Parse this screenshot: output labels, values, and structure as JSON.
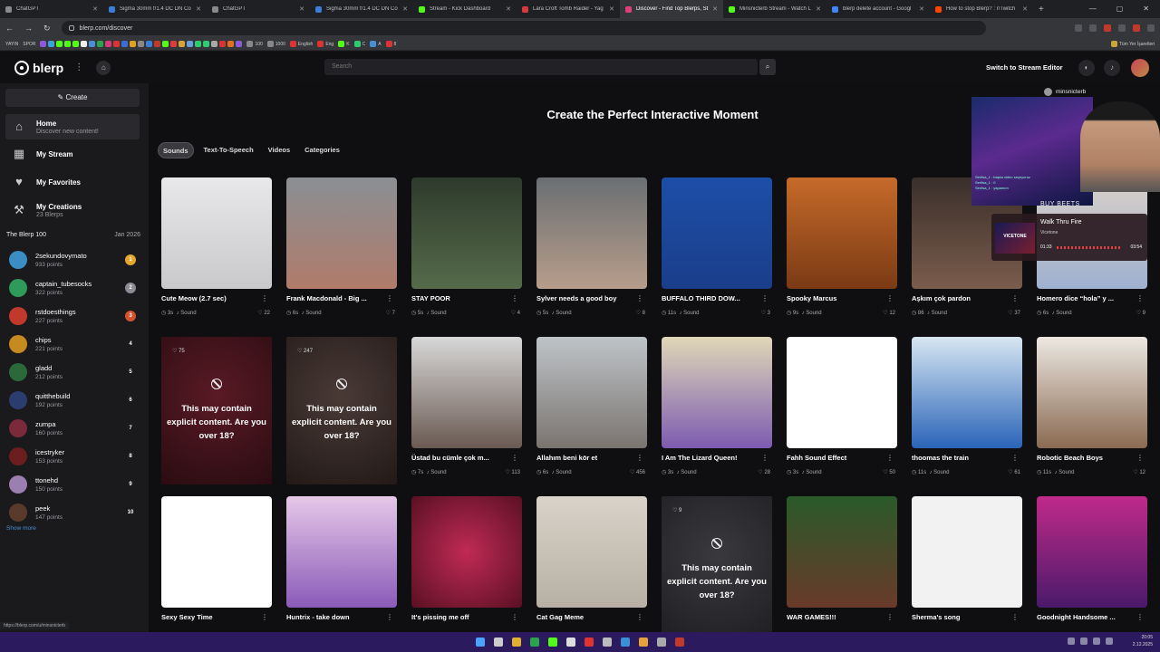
{
  "browser": {
    "tabs": [
      {
        "title": "ChatGPT",
        "color": "#8a8a8a",
        "active": false
      },
      {
        "title": "Sigma 30mm f/1.4 DC DN Co",
        "color": "#3b7dd8",
        "active": false
      },
      {
        "title": "ChatGPT",
        "color": "#8a8a8a",
        "active": false
      },
      {
        "title": "Sigma 30mm f/1.4 DC DN Co",
        "color": "#3b7dd8",
        "active": false
      },
      {
        "title": "Stream - Kick Dashboard",
        "color": "#53fc18",
        "active": false
      },
      {
        "title": "Lara Croft Tomb Raider - Yag",
        "color": "#d63a3a",
        "active": false
      },
      {
        "title": "Discover - Find Top Blerps, St",
        "color": "#e0407a",
        "active": true
      },
      {
        "title": "Minsnicterb Stream - Watch L",
        "color": "#53fc18",
        "active": false
      },
      {
        "title": "blerp delete account - Googl",
        "color": "#4285f4",
        "active": false
      },
      {
        "title": "How to stop Blerp? : r/Twitch",
        "color": "#ff4500",
        "active": false
      }
    ],
    "url": "blerp.com/discover",
    "bookmarks": [
      "YAYIN",
      "SPOR",
      "100",
      "1000",
      "English",
      "Eng",
      "K",
      "C",
      "A",
      "8"
    ],
    "bookmarks_folder": "Tüm Yer İşaretleri",
    "status_url": "https://blerp.com/u/minsnicterb"
  },
  "header": {
    "logo": "blerp",
    "search_placeholder": "Search",
    "switch_label": "Switch to Stream Editor"
  },
  "sidebar": {
    "create_label": "Create",
    "nav": [
      {
        "label": "Home",
        "sub": "Discover new content!",
        "icon": "home-icon"
      },
      {
        "label": "My Stream",
        "sub": "",
        "icon": "stream-icon"
      },
      {
        "label": "My Favorites",
        "sub": "",
        "icon": "heart-icon"
      },
      {
        "label": "My Creations",
        "sub": "23 Blerps",
        "icon": "hammer-icon"
      }
    ],
    "blerp100_title": "The Blerp 100",
    "blerp100_date": "Jan 2026",
    "leaderboard": [
      {
        "name": "2sekundovymato",
        "points": "933 points",
        "rank": "1",
        "color": "#3a8ec4",
        "rank_color": "#e3a82b"
      },
      {
        "name": "captain_tubesocks",
        "points": "322 points",
        "rank": "2",
        "color": "#2f9b5a",
        "rank_color": "#8c8c94"
      },
      {
        "name": "rstdoesthings",
        "points": "227 points",
        "rank": "3",
        "color": "#c0392b",
        "rank_color": "#d3532f"
      },
      {
        "name": "chips",
        "points": "221 points",
        "rank": "4",
        "color": "#c78a20",
        "rank_color": "transparent"
      },
      {
        "name": "gladd",
        "points": "212 points",
        "rank": "5",
        "color": "#2a6a3a",
        "rank_color": "transparent"
      },
      {
        "name": "quitthebuild",
        "points": "192 points",
        "rank": "6",
        "color": "#2b3d6f",
        "rank_color": "transparent"
      },
      {
        "name": "zumpa",
        "points": "160 points",
        "rank": "7",
        "color": "#7a2a3a",
        "rank_color": "transparent"
      },
      {
        "name": "icestryker",
        "points": "153 points",
        "rank": "8",
        "color": "#6a1e1e",
        "rank_color": "transparent"
      },
      {
        "name": "ttonehd",
        "points": "150 points",
        "rank": "9",
        "color": "#9a7fb0",
        "rank_color": "transparent"
      },
      {
        "name": "peek",
        "points": "147 points",
        "rank": "10",
        "color": "#5a3a2a",
        "rank_color": "transparent"
      }
    ],
    "show_more": "Show more"
  },
  "main": {
    "heading": "Create the Perfect Interactive Moment",
    "tabs": [
      "Sounds",
      "Text-To-Speech",
      "Videos",
      "Categories"
    ],
    "warning": "This may contain explicit content. Are you over 18?",
    "sound_label": "Sound",
    "cards": [
      {
        "title": "Cute Meow (2.7 sec)",
        "dur": "3s",
        "likes": "22",
        "bg": "linear-gradient(180deg,#e8e8ea,#c9c9cc)",
        "explicit": false
      },
      {
        "title": "Frank Macdonald - Big ...",
        "dur": "6s",
        "likes": "7",
        "bg": "linear-gradient(180deg,#8a8f94,#b07b6a)",
        "explicit": false
      },
      {
        "title": "STAY POOR",
        "dur": "5s",
        "likes": "4",
        "bg": "linear-gradient(180deg,#2e3a2c,#556b4a)",
        "explicit": false
      },
      {
        "title": "Sylver needs a good boy",
        "dur": "5s",
        "likes": "8",
        "bg": "linear-gradient(180deg,#6a6f73,#b79d8a)",
        "explicit": false
      },
      {
        "title": "BUFFALO THIRD DOW...",
        "dur": "11s",
        "likes": "3",
        "bg": "linear-gradient(180deg,#1d4ea8,#1a3e8a)",
        "explicit": false
      },
      {
        "title": "Spooky Marcus",
        "dur": "9s",
        "likes": "12",
        "bg": "linear-gradient(180deg,#c66a2a,#7a3a14)",
        "explicit": false
      },
      {
        "title": "Aşkım çok pardon",
        "dur": "86",
        "likes": "37",
        "bg": "linear-gradient(180deg,#3a2f2b,#7a5c4c)",
        "explicit": false
      },
      {
        "title": "Homero dice “hola” y ...",
        "dur": "6s",
        "likes": "9",
        "bg": "linear-gradient(180deg,#d8d0c8,#9fb0d0)",
        "explicit": false
      },
      {
        "title": "",
        "dur": "",
        "likes": "75",
        "bg": "radial-gradient(circle at 50% 40%,#5a1a24,#2a0c12)",
        "explicit": true
      },
      {
        "title": "",
        "dur": "",
        "likes": "247",
        "bg": "radial-gradient(circle at 50% 40%,#4a3a36,#221a18)",
        "explicit": true
      },
      {
        "title": "Üstad bu cümle çok m...",
        "dur": "7s",
        "likes": "113",
        "bg": "linear-gradient(180deg,#d8d8d8,#6a5a52)",
        "explicit": false
      },
      {
        "title": "Allahım beni kör et",
        "dur": "6s",
        "likes": "456",
        "bg": "linear-gradient(180deg,#bfc4c8,#7a7470)",
        "explicit": false
      },
      {
        "title": "I Am The Lizard Queen!",
        "dur": "3s",
        "likes": "28",
        "bg": "linear-gradient(180deg,#e0d8b8,#7c5bb0)",
        "explicit": false
      },
      {
        "title": "Fahh Sound Effect",
        "dur": "3s",
        "likes": "50",
        "bg": "#ffffff",
        "explicit": false
      },
      {
        "title": "thoomas the train",
        "dur": "11s",
        "likes": "61",
        "bg": "linear-gradient(180deg,#d7e6f2,#2a64b8)",
        "explicit": false
      },
      {
        "title": "Robotic Beach Boys",
        "dur": "11s",
        "likes": "12",
        "bg": "linear-gradient(180deg,#ece8e2,#8a6a52)",
        "explicit": false
      },
      {
        "title": "Sexy Sexy Time",
        "dur": "",
        "likes": "",
        "bg": "#ffffff",
        "explicit": false
      },
      {
        "title": "Huntrix - take down",
        "dur": "",
        "likes": "",
        "bg": "linear-gradient(180deg,#e6c8e8,#8a5ab8)",
        "explicit": false
      },
      {
        "title": "It's pissing me off",
        "dur": "",
        "likes": "",
        "bg": "radial-gradient(circle,#c02a54,#5a1024)",
        "explicit": false
      },
      {
        "title": "Cat Gag Meme",
        "dur": "",
        "likes": "",
        "bg": "linear-gradient(180deg,#d8d2c8,#b8b0a4)",
        "explicit": false
      },
      {
        "title": "",
        "dur": "",
        "likes": "9",
        "bg": "radial-gradient(circle at 50% 40%,#3a3a3e,#1e1e22)",
        "explicit": true
      },
      {
        "title": "WAR GAMES!!!",
        "dur": "",
        "likes": "",
        "bg": "linear-gradient(180deg,#2a5a2a,#6a3a2a)",
        "explicit": false
      },
      {
        "title": "Sherma's song",
        "dur": "",
        "likes": "",
        "bg": "#f2f2f2",
        "explicit": false
      },
      {
        "title": "Goodnight Handsome ...",
        "dur": "",
        "likes": "",
        "bg": "linear-gradient(180deg,#c02a8a,#4a1a6a)",
        "explicit": false
      }
    ]
  },
  "overlay": {
    "username": "minsnicterb",
    "chat": [
      "Serifsa_1 : başka video seçeyoruz",
      "Serifsa_1 : 0",
      "Serifsa_1 : yapamım"
    ],
    "buy_beets": "BUY BEETS",
    "song_title": "Walk Thru Fire",
    "song_artist": "Vicetone",
    "album_text": "VICETONE",
    "time_elapsed": "01:33",
    "time_total": "03:54"
  },
  "taskbar": {
    "time": "20:05",
    "date": "2.12.2025"
  }
}
